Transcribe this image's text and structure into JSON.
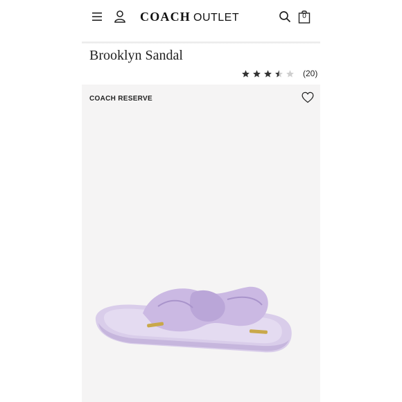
{
  "header": {
    "brand": "COACH",
    "outlet": "OUTLET",
    "bag_count": "0",
    "icons": [
      "menu-icon",
      "account-icon",
      "search-icon",
      "shopping-bag-icon"
    ]
  },
  "product": {
    "title": "Brooklyn Sandal",
    "rating_value": 3.5,
    "rating_max": 5,
    "review_count": "(20)",
    "collection": "COACH RESERVE",
    "color": "#d8c8ec"
  },
  "colors": {
    "accent": "#111111",
    "background": "#f5f4f4"
  }
}
